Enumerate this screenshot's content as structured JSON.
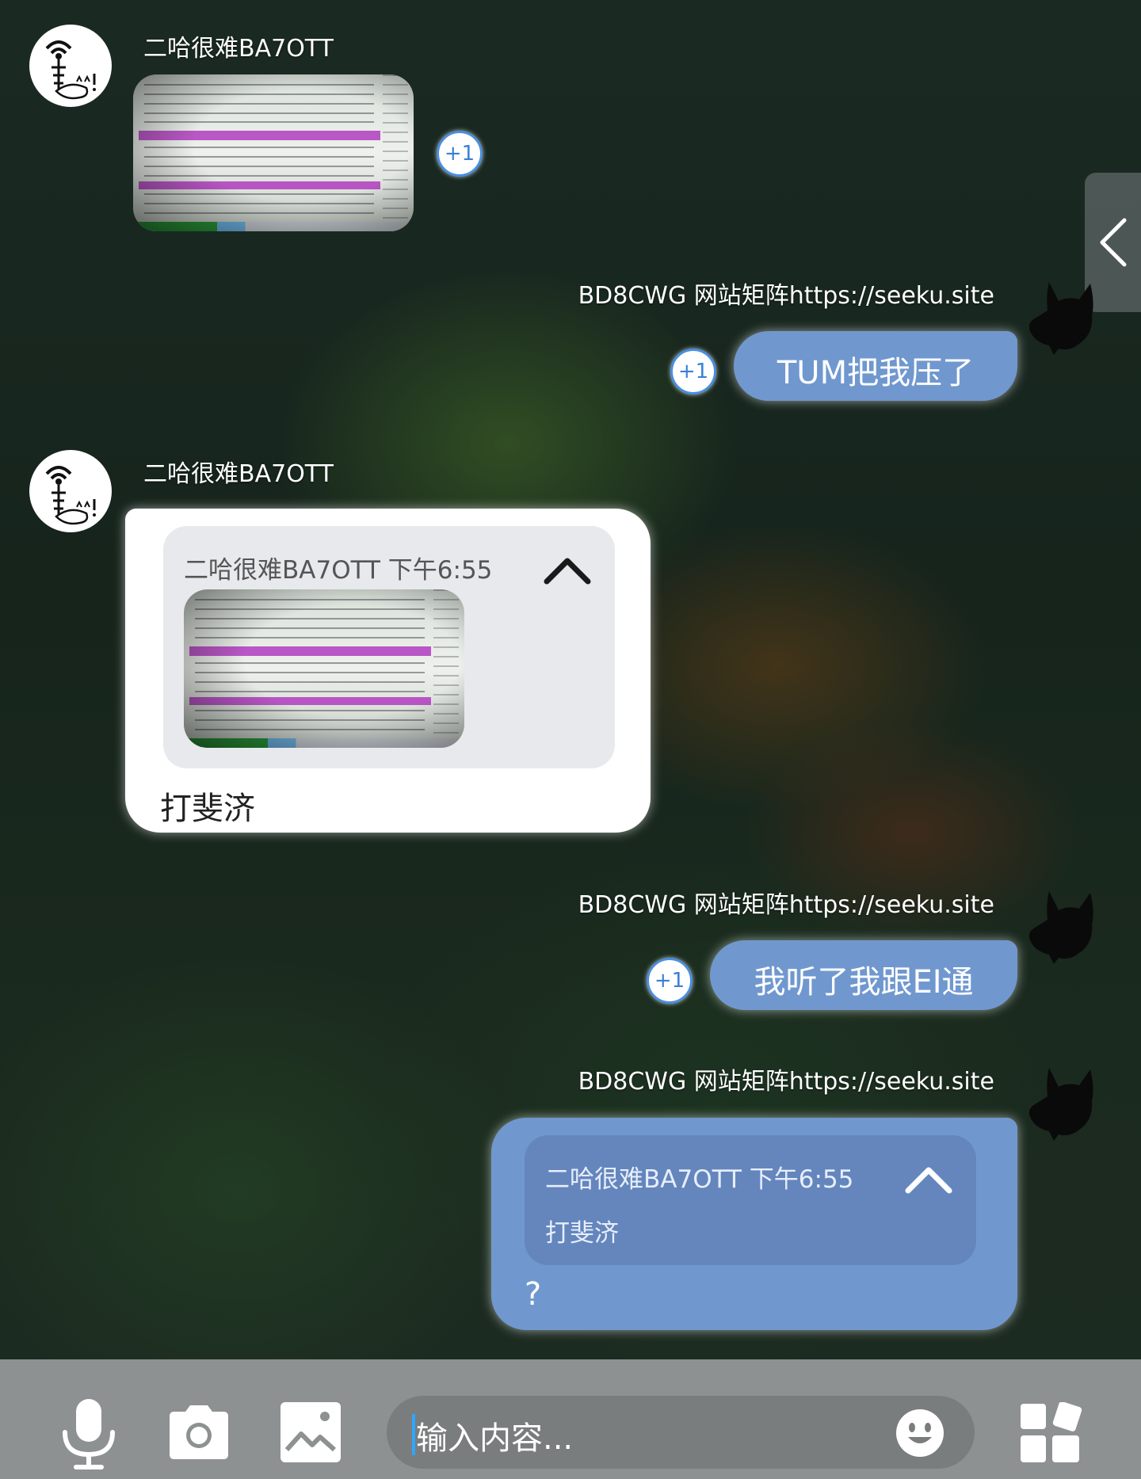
{
  "messages": [
    {
      "sender": "二哈很难BA7OTT",
      "type": "image",
      "plus_one": "+1"
    },
    {
      "sender": "BD8CWG 网站矩阵https://seeku.site",
      "type": "text",
      "text": "TUM把我压了",
      "plus_one": "+1"
    },
    {
      "sender": "二哈很难BA7OTT",
      "type": "quote",
      "quote_title": "二哈很难BA7OTT 下午6:55",
      "text": "打斐济"
    },
    {
      "sender": "BD8CWG 网站矩阵https://seeku.site",
      "type": "text",
      "text": "我听了我跟EI通",
      "plus_one": "+1"
    },
    {
      "sender": "BD8CWG 网站矩阵https://seeku.site",
      "type": "quote",
      "quote_title": "二哈很难BA7OTT 下午6:55",
      "quote_text": "打斐济",
      "text": "?"
    }
  ],
  "composer": {
    "placeholder": "输入内容...",
    "icons": [
      "microphone-icon",
      "camera-icon",
      "image-icon",
      "emoji-icon",
      "apps-icon"
    ]
  },
  "colors": {
    "blue_bubble": "#7098cf",
    "white_bubble": "#ffffff",
    "accent": "#4a8ee0",
    "bottom_bar": "#8e9191"
  }
}
